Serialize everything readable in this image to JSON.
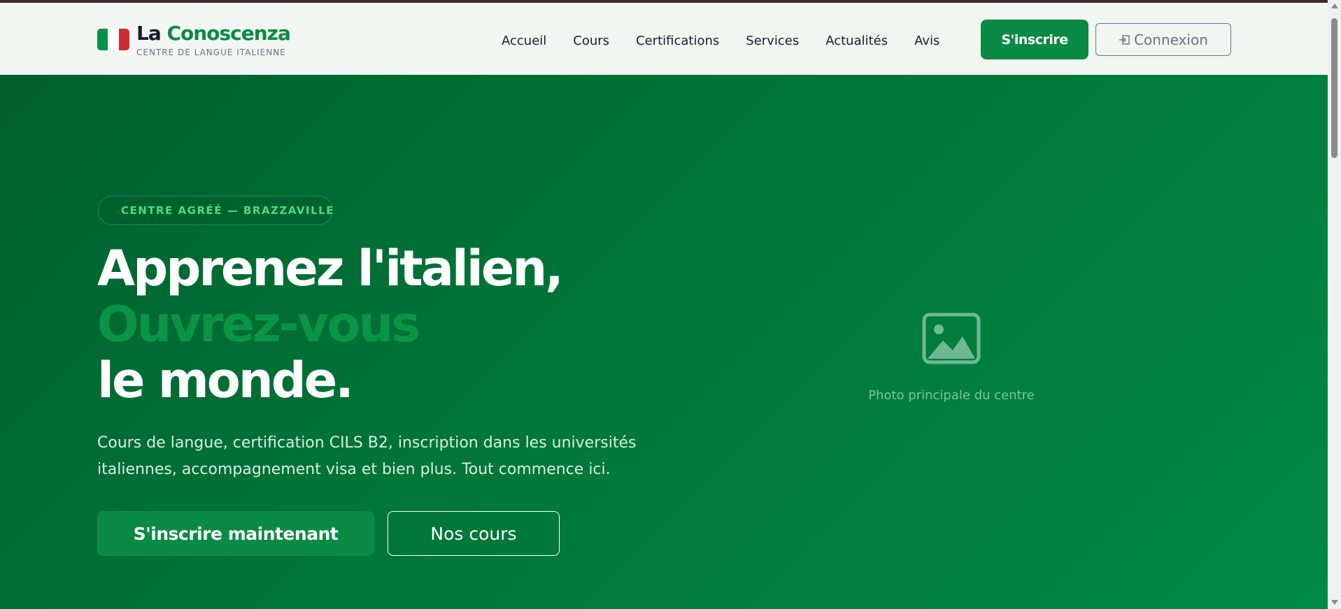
{
  "brand": {
    "name_part1": "La",
    "name_part2": "Conoscenza",
    "subtitle": "CENTRE DE LANGUE ITALIENNE",
    "flag_icon": "italy-flag-icon"
  },
  "nav": {
    "items": [
      {
        "label": "Accueil"
      },
      {
        "label": "Cours"
      },
      {
        "label": "Certifications"
      },
      {
        "label": "Services"
      },
      {
        "label": "Actualités"
      },
      {
        "label": "Avis"
      }
    ],
    "signup_label": "S'inscrire",
    "login_label": "Connexion",
    "login_icon": "login-icon"
  },
  "hero": {
    "badge": "CENTRE AGRÉÉ — BRAZZAVILLE",
    "badge_icon": "verified-check-icon",
    "headline_line1": "Apprenez l'italien,",
    "headline_line2": "Ouvrez-vous",
    "headline_line3": "le monde.",
    "lead": "Cours de langue, certification CILS B2, inscription dans les universités italiennes, accompagnement visa et bien plus. Tout commence ici.",
    "cta_primary": "S'inscrire maintenant",
    "cta_secondary": "Nos cours",
    "photo_icon": "image-placeholder-icon",
    "photo_caption": "Photo principale du centre"
  },
  "colors": {
    "brand_green": "#0a8a45",
    "hero_green": "#00793a",
    "accent_light_green": "#4ade80",
    "header_bg": "#f1f6f3",
    "dark_text": "#1a1d2b"
  }
}
